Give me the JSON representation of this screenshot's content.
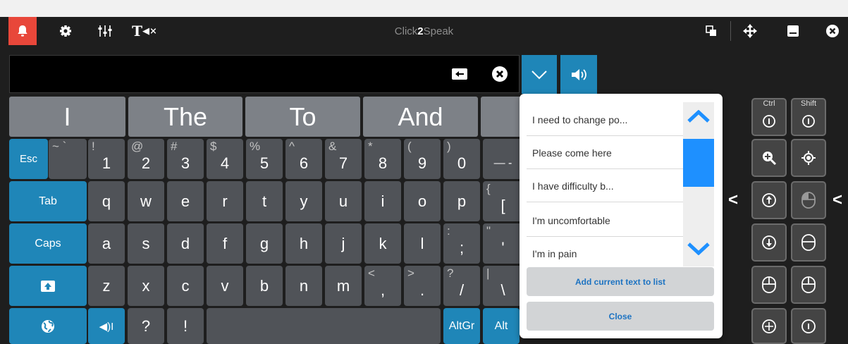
{
  "app": {
    "title_part1": "Click",
    "title_part2": "2",
    "title_part3": "Speak"
  },
  "titlebar": {
    "left_icons": [
      "bell-icon",
      "gear-icon",
      "sliders-icon",
      "text-mute-icon"
    ],
    "right_icons": [
      "copy-icon",
      "move-icon",
      "minimize-icon",
      "close-icon"
    ]
  },
  "textbar": {
    "value": "",
    "clear_icon": "backspace-icon",
    "close_icon": "close-circle-icon",
    "dropdown_icon": "chevron-down-icon",
    "speak_icon": "speaker-icon"
  },
  "word_predictions": [
    "I",
    "The",
    "To",
    "And"
  ],
  "keys": {
    "row1": [
      {
        "main": "Esc"
      },
      {
        "shift": "~ `",
        "main": ""
      },
      {
        "shift": "!",
        "main": "1"
      },
      {
        "shift": "@",
        "main": "2"
      },
      {
        "shift": "#",
        "main": "3"
      },
      {
        "shift": "$",
        "main": "4"
      },
      {
        "shift": "%",
        "main": "5"
      },
      {
        "shift": "^",
        "main": "6"
      },
      {
        "shift": "&",
        "main": "7"
      },
      {
        "shift": "*",
        "main": "8"
      },
      {
        "shift": "(",
        "main": "9"
      },
      {
        "shift": ")",
        "main": "0"
      },
      {
        "shift": "",
        "main": "— -"
      }
    ],
    "row2": [
      {
        "main": "Tab"
      },
      {
        "main": "q"
      },
      {
        "main": "w"
      },
      {
        "main": "e"
      },
      {
        "main": "r"
      },
      {
        "main": "t"
      },
      {
        "main": "y"
      },
      {
        "main": "u"
      },
      {
        "main": "i"
      },
      {
        "main": "o"
      },
      {
        "main": "p"
      },
      {
        "shift": "{",
        "main": "["
      }
    ],
    "row3": [
      {
        "main": "Caps"
      },
      {
        "main": "a"
      },
      {
        "main": "s"
      },
      {
        "main": "d"
      },
      {
        "main": "f"
      },
      {
        "main": "g"
      },
      {
        "main": "h"
      },
      {
        "main": "j"
      },
      {
        "main": "k"
      },
      {
        "main": "l"
      },
      {
        "shift": ":",
        "main": ";"
      },
      {
        "shift": "\"",
        "main": "'"
      }
    ],
    "row4": [
      {
        "main": "z"
      },
      {
        "main": "x"
      },
      {
        "main": "c"
      },
      {
        "main": "v"
      },
      {
        "main": "b"
      },
      {
        "main": "n"
      },
      {
        "main": "m"
      },
      {
        "shift": "<",
        "main": ","
      },
      {
        "shift": ">",
        "main": "."
      },
      {
        "shift": "?",
        "main": "/"
      },
      {
        "shift": "|",
        "main": "\\"
      }
    ],
    "row5": {
      "q": "?",
      "ex": "!",
      "altgr": "AltGr",
      "alt": "Alt"
    },
    "shift_icon": "shift-up-icon",
    "globe_icon": "globe-icon",
    "speak_cursor_icon": "speak-cursor-icon"
  },
  "phrases": {
    "items": [
      "I need to change po...",
      "Please come here",
      "I have difficulty b...",
      "I'm uncomfortable",
      "I'm in pain"
    ],
    "add_label": "Add current text to list",
    "close_label": "Close",
    "scroll_progress": 0.15
  },
  "side_panel": {
    "ctrl": "Ctrl",
    "shift": "Shift",
    "arrow": "<",
    "icons": [
      "zoom-in-icon",
      "target-icon",
      "scroll-up-icon",
      "mouse-left-icon",
      "scroll-down-icon",
      "mouse-right-icon",
      "mouse-2-icon",
      "mouse-3-icon",
      "move-cursor-icon",
      "info-icon"
    ]
  },
  "colors": {
    "accent_blue": "#1f86b8",
    "bell_red": "#e8473a",
    "phrase_text": "#1d73c2",
    "scroll_blue": "#1e90ff"
  }
}
